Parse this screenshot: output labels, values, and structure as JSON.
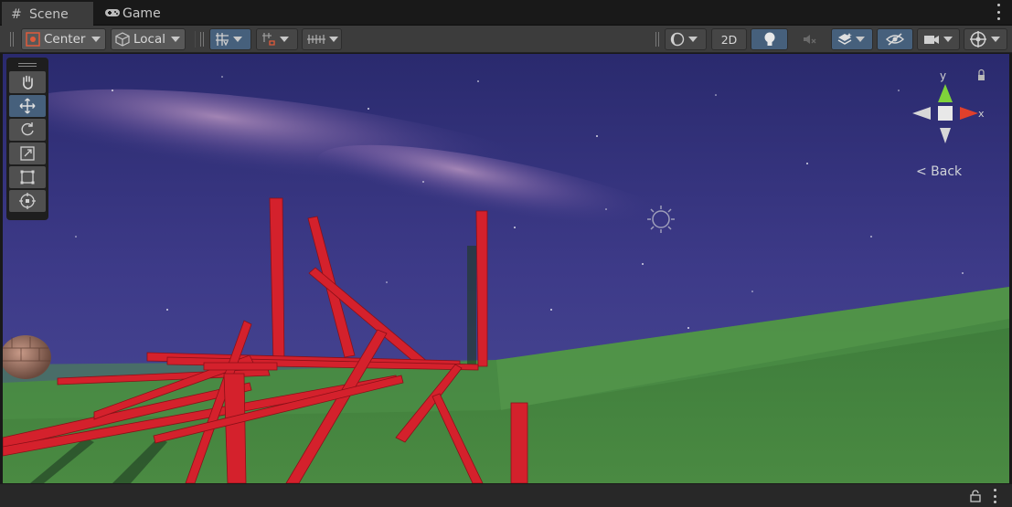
{
  "tabs": {
    "scene_label": "Scene",
    "game_label": "Game"
  },
  "toolbar": {
    "pivot_label": "Center",
    "space_label": "Local",
    "mode_2d_label": "2D"
  },
  "gizmo": {
    "y_label": "y",
    "x_label": "x",
    "back_label": "< Back"
  },
  "tools": [
    "hand-icon",
    "move-icon",
    "rotate-icon",
    "scale-icon",
    "rect-transform-icon",
    "transform-icon"
  ],
  "colors": {
    "accent_selected": "#46607c",
    "sky": "#3d3a88",
    "ground": "#3e7d3c",
    "planks": "#d4212c",
    "gizmo_y": "#7fd23a",
    "gizmo_x": "#e0402c"
  }
}
